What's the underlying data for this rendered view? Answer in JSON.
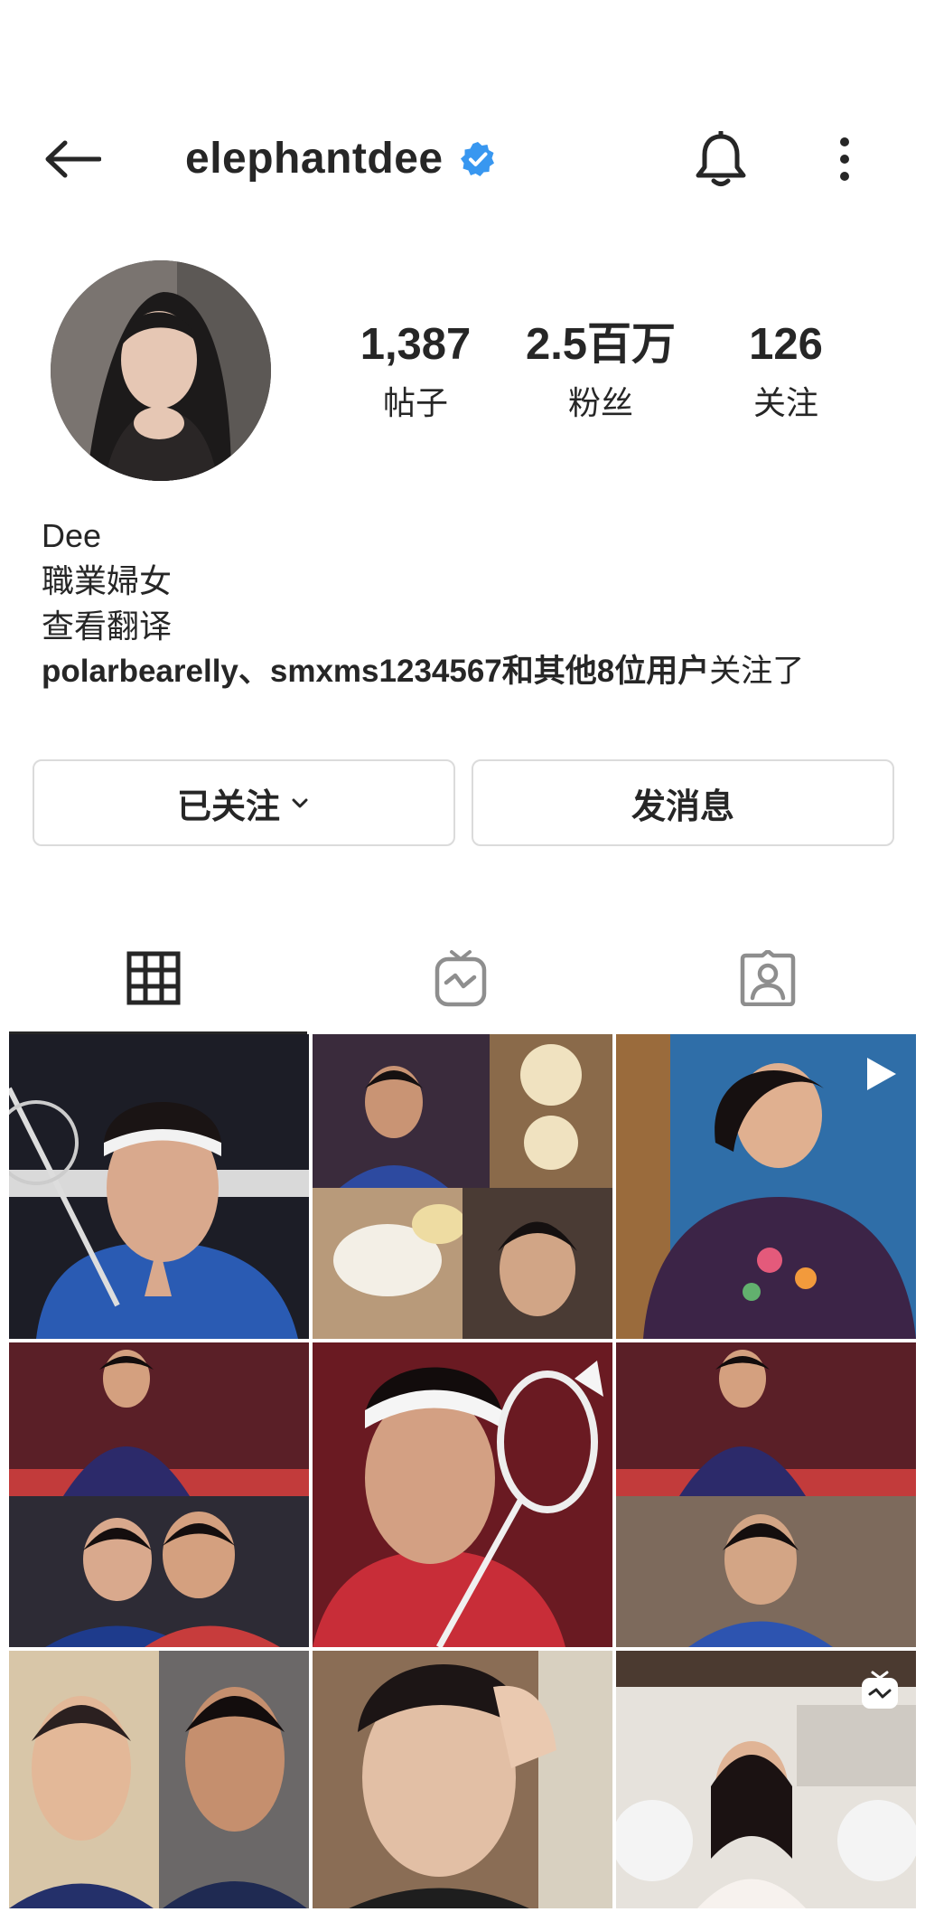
{
  "header": {
    "username": "elephantdee",
    "verified": true
  },
  "stats": {
    "posts_count": "1,387",
    "posts_label": "帖子",
    "followers_count": "2.5百万",
    "followers_label": "粉丝",
    "following_count": "126",
    "following_label": "关注"
  },
  "bio": {
    "name": "Dee",
    "description": "職業婦女",
    "translate": "查看翻译",
    "followed_by_users": "polarbearelly、smxms1234567",
    "followed_by_suffix": "和其他8位用户",
    "followed_by_tail": "关注了"
  },
  "actions": {
    "following_label": "已关注",
    "message_label": "发消息"
  },
  "tabs": [
    {
      "icon": "grid-icon",
      "active": true
    },
    {
      "icon": "igtv-icon",
      "active": false
    },
    {
      "icon": "tagged-icon",
      "active": false
    }
  ],
  "grid": {
    "tiles": [
      {
        "badge": ""
      },
      {
        "badge": ""
      },
      {
        "badge": "video-icon"
      },
      {
        "badge": ""
      },
      {
        "badge": ""
      },
      {
        "badge": ""
      },
      {
        "badge": ""
      },
      {
        "badge": ""
      },
      {
        "badge": "igtv-icon"
      }
    ]
  },
  "colors": {
    "text": "#262626",
    "verified_blue": "#3897f0",
    "border": "#dbdbdb",
    "icon_gray": "#8e8e8e"
  }
}
